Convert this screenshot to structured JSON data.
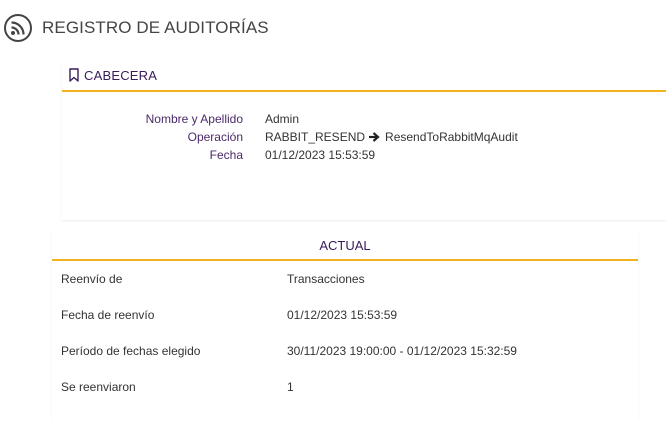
{
  "header": {
    "title": "REGISTRO DE AUDITORÍAS",
    "icon": "rss-feed-icon"
  },
  "cabecera": {
    "title": "CABECERA",
    "icon": "bookmark-icon",
    "accent_color": "#f0b31f",
    "fields": [
      {
        "label": "Nombre y Apellido",
        "value": "Admin"
      },
      {
        "label": "Operación",
        "value_left": "RABBIT_RESEND",
        "value_right": "ResendToRabbitMqAudit"
      },
      {
        "label": "Fecha",
        "value": "01/12/2023 15:53:59"
      }
    ]
  },
  "actual": {
    "title": "ACTUAL",
    "rows": [
      {
        "label": "Reenvío de",
        "value": "Transacciones"
      },
      {
        "label": "Fecha de reenvío",
        "value": "01/12/2023 15:53:59"
      },
      {
        "label": "Período de fechas elegido",
        "value": "30/11/2023 19:00:00 - 01/12/2023 15:32:59"
      },
      {
        "label": "Se reenviaron",
        "value": "1"
      }
    ]
  }
}
